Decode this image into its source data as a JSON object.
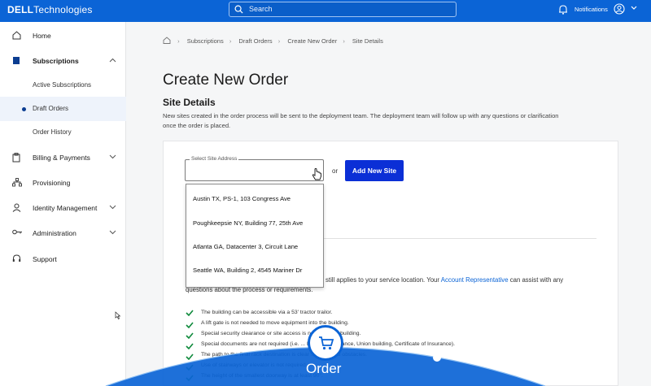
{
  "header": {
    "logo_bold": "DELL",
    "logo_text": "Technologies",
    "search_placeholder": "Search",
    "notifications_label": "Notifications"
  },
  "sidebar": {
    "items": [
      {
        "label": "Home",
        "icon": "home-icon"
      },
      {
        "label": "Subscriptions",
        "icon": "subscriptions-icon"
      },
      {
        "label": "Billing & Payments",
        "icon": "billing-icon"
      },
      {
        "label": "Provisioning",
        "icon": "provisioning-icon"
      },
      {
        "label": "Identity Management",
        "icon": "identity-icon"
      },
      {
        "label": "Administration",
        "icon": "administration-icon"
      },
      {
        "label": "Support",
        "icon": "support-icon"
      }
    ],
    "sub_items": [
      {
        "label": "Active Subscriptions"
      },
      {
        "label": "Draft Orders"
      },
      {
        "label": "Order History"
      }
    ]
  },
  "breadcrumb": [
    "Subscriptions",
    "Draft Orders",
    "Create New Order",
    "Site Details"
  ],
  "main": {
    "title": "Create New Order",
    "section_title": "Site Details",
    "description": "New sites created in the order process will be sent to the deployment team. The deployment team will follow up with any questions or clarification once the order is placed.",
    "select_label": "Select Site Address",
    "or_text": "or",
    "add_site_button": "Add New Site",
    "dropdown_options": [
      "Austin TX, PS-1, 103 Congress Ave",
      "Poughkeepsie NY, Building 77, 25th Ave",
      "Atlanta GA, Datacenter 3, Circuit Lane",
      "Seattle WA, Building 2, 4545 Mariner Dr"
    ],
    "requirements_text_a": "still applies to your service location. Your",
    "requirements_link": "Account Representative",
    "requirements_text_b": "can assist with any",
    "requirements_text_c": "questions about the process or requirements.",
    "checklist": [
      "The building can be accessible via a 53' tractor trailor.",
      "A lift gate is not needed to move equipment into the building.",
      "Special security clearance or site access is n... enter the building.",
      "Special documents are not required (i.e. ... Export Compliance, Union building, Certificate of Insurance).",
      "The path to the final rack destination is clear ...ctions and obstacles.",
      "Use of stairways or elevator is not required.",
      "The height of the smallest doorway is at least 90\"."
    ]
  },
  "overlay": {
    "order_label": "Order"
  },
  "colors": {
    "brand_blue": "#0b64d6",
    "button_blue": "#0b2fd6",
    "check_green": "#0f8a3c"
  }
}
